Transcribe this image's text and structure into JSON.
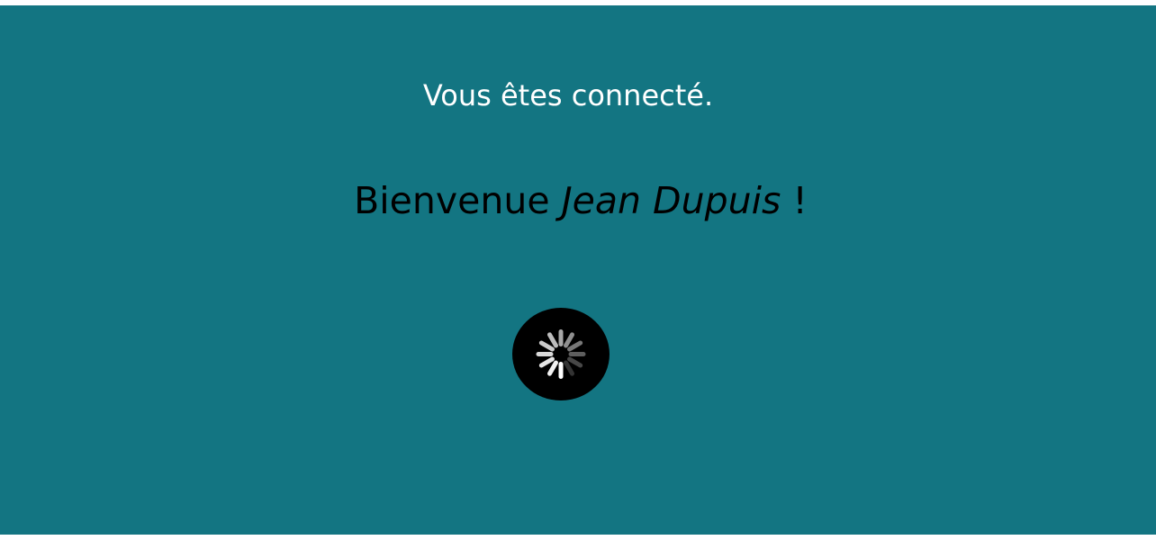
{
  "status_message": "Vous êtes connecté.",
  "welcome": {
    "prefix": "Bienvenue ",
    "user_name": "Jean Dupuis",
    "suffix": " !"
  },
  "spinner": {
    "icon": "loading-spinner-icon",
    "background_color": "#000000"
  },
  "colors": {
    "page_background": "#137582",
    "status_text": "#ffffff",
    "welcome_text": "#000000"
  }
}
